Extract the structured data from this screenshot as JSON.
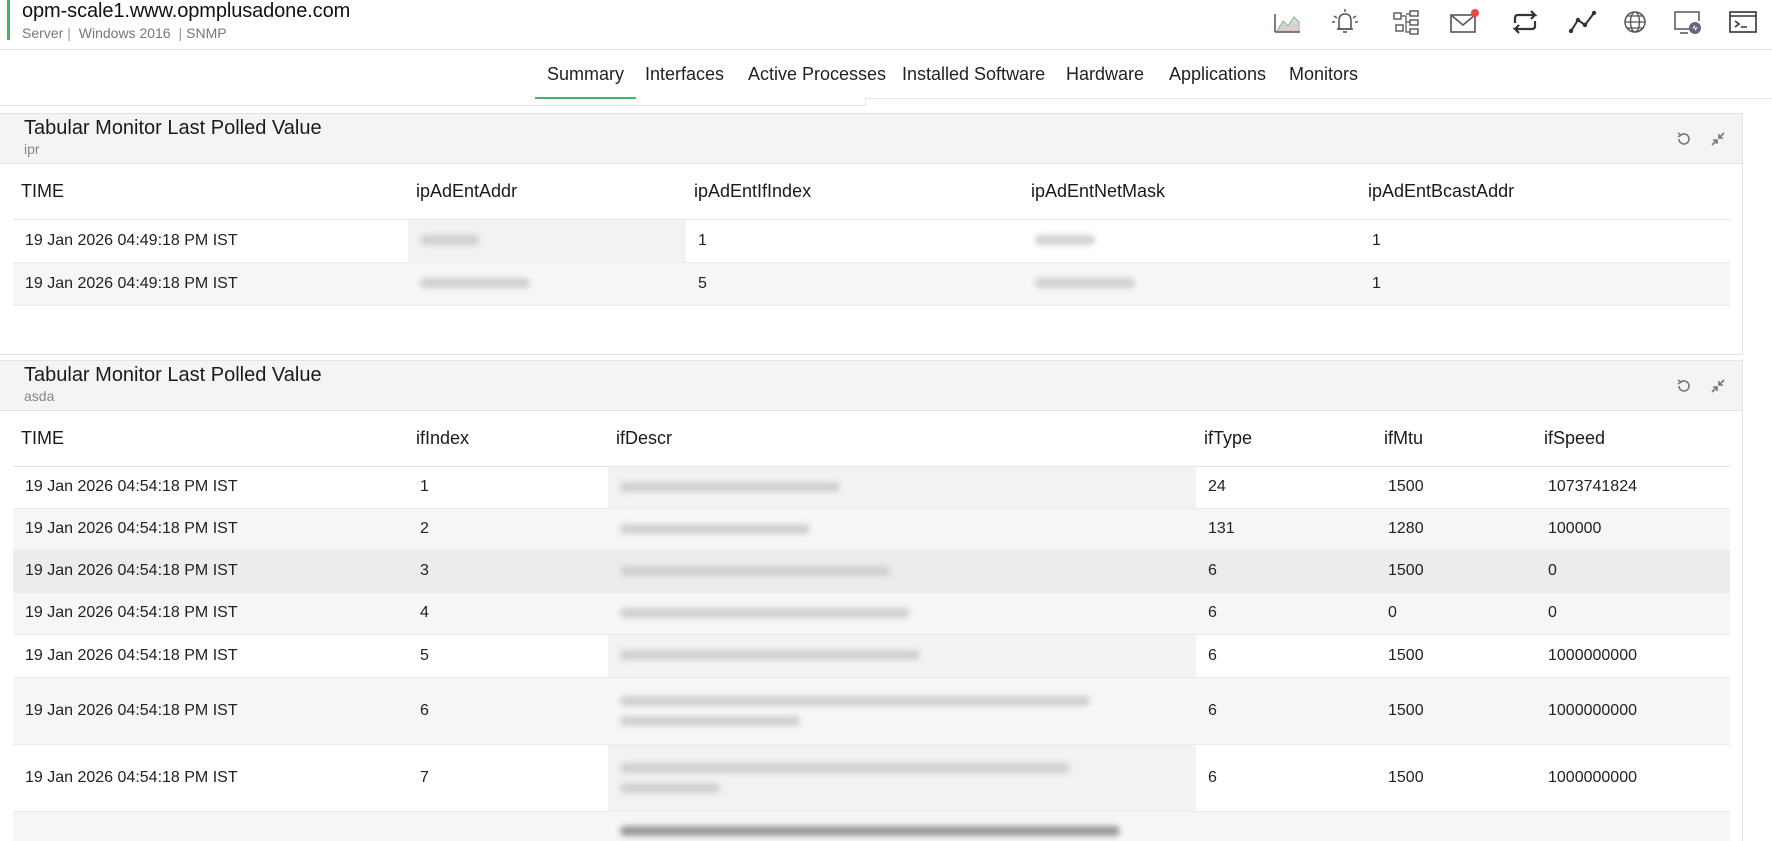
{
  "header": {
    "host": "opm-scale1.www.opmplusadone.com",
    "type": "Server",
    "os": "Windows 2016",
    "protocol": "SNMP",
    "separator": "|"
  },
  "toolbar": {
    "icons": [
      "chart-icon",
      "alarm-bell-icon",
      "network-map-icon",
      "mail-icon",
      "sync-icon",
      "graph-line-icon",
      "globe-icon",
      "remote-desktop-icon",
      "terminal-icon"
    ],
    "mail_badge_color": "#e74c3c"
  },
  "tabs": [
    {
      "label": "Summary",
      "active": true
    },
    {
      "label": "Interfaces",
      "active": false
    },
    {
      "label": "Active Processes",
      "active": false
    },
    {
      "label": "Installed Software",
      "active": false
    },
    {
      "label": "Hardware",
      "active": false
    },
    {
      "label": "Applications",
      "active": false
    },
    {
      "label": "Monitors",
      "active": false
    }
  ],
  "colors": {
    "accent": "#3cba63",
    "panel_header_bg": "#f4f4f4"
  },
  "panel1": {
    "title": "Tabular Monitor Last Polled Value",
    "subtitle": "ipr",
    "columns": [
      "TIME",
      "ipAdEntAddr",
      "ipAdEntIfIndex",
      "ipAdEntNetMask",
      "ipAdEntBcastAddr"
    ],
    "rows": [
      [
        "19 Jan 2026 04:49:18 PM IST",
        "",
        "1",
        "",
        "1"
      ],
      [
        "19 Jan 2026 04:49:18 PM IST",
        "",
        "5",
        "",
        "1"
      ]
    ]
  },
  "panel2": {
    "title": "Tabular Monitor Last Polled Value",
    "subtitle": "asda",
    "columns": [
      "TIME",
      "ifIndex",
      "ifDescr",
      "ifType",
      "ifMtu",
      "ifSpeed"
    ],
    "rows": [
      [
        "19 Jan 2026 04:54:18 PM IST",
        "1",
        "",
        "24",
        "1500",
        "1073741824"
      ],
      [
        "19 Jan 2026 04:54:18 PM IST",
        "2",
        "",
        "131",
        "1280",
        "100000"
      ],
      [
        "19 Jan 2026 04:54:18 PM IST",
        "3",
        "",
        "6",
        "1500",
        "0"
      ],
      [
        "19 Jan 2026 04:54:18 PM IST",
        "4",
        "",
        "6",
        "0",
        "0"
      ],
      [
        "19 Jan 2026 04:54:18 PM IST",
        "5",
        "",
        "6",
        "1500",
        "1000000000"
      ],
      [
        "19 Jan 2026 04:54:18 PM IST",
        "6",
        "",
        "6",
        "1500",
        "1000000000"
      ],
      [
        "19 Jan 2026 04:54:18 PM IST",
        "7",
        "",
        "6",
        "1500",
        "1000000000"
      ]
    ]
  }
}
